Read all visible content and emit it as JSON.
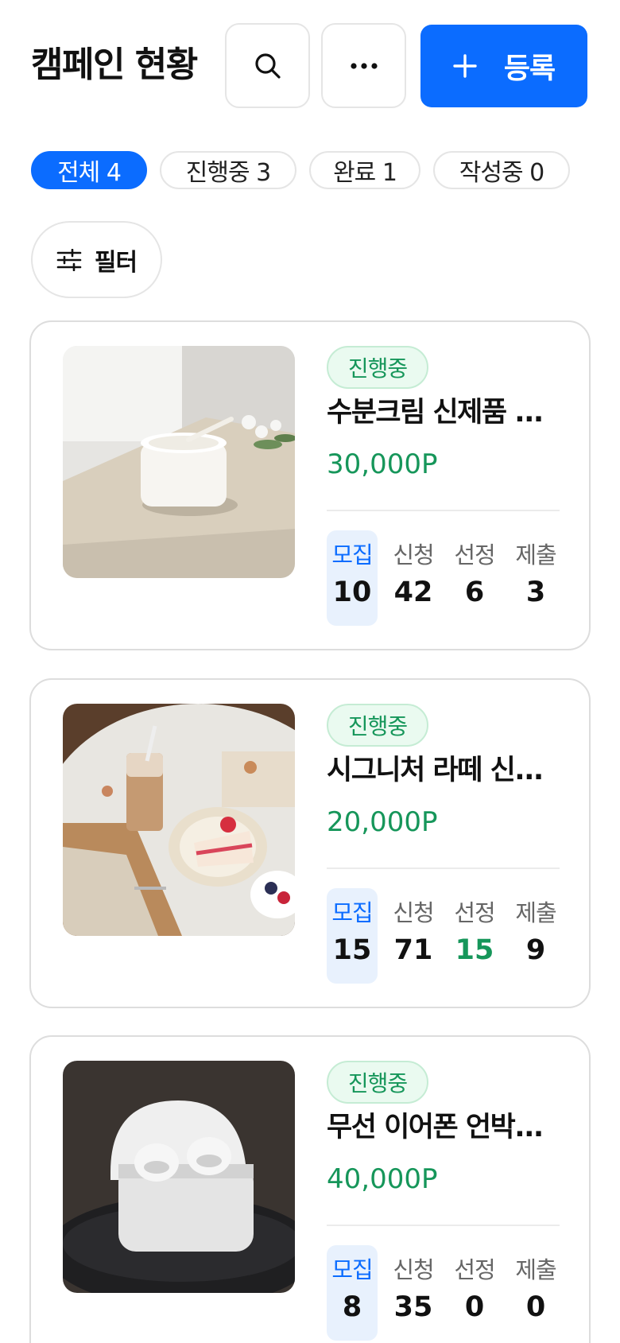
{
  "header": {
    "title": "캠페인 현황",
    "register_label": "등록"
  },
  "tabs": [
    {
      "label": "전체 4",
      "active": true
    },
    {
      "label": "진행중 3",
      "active": false
    },
    {
      "label": "완료 1",
      "active": false
    },
    {
      "label": "작성중 0",
      "active": false
    }
  ],
  "filter": {
    "label": "필터"
  },
  "stat_labels": [
    "모집",
    "신청",
    "선정",
    "제출"
  ],
  "campaigns": [
    {
      "status": "진행중",
      "title": "수분크림 신제품 ...",
      "points": "30,000P",
      "stats": [
        "10",
        "42",
        "6",
        "3"
      ]
    },
    {
      "status": "진행중",
      "title": "시그니처 라떼 신...",
      "points": "20,000P",
      "stats": [
        "15",
        "71",
        "15",
        "9"
      ]
    },
    {
      "status": "진행중",
      "title": "무선 이어폰 언박...",
      "points": "40,000P",
      "stats": [
        "8",
        "35",
        "0",
        "0"
      ]
    }
  ],
  "colors": {
    "primary": "#0b6cff",
    "success": "#16965a",
    "border": "#e5e5e5"
  }
}
